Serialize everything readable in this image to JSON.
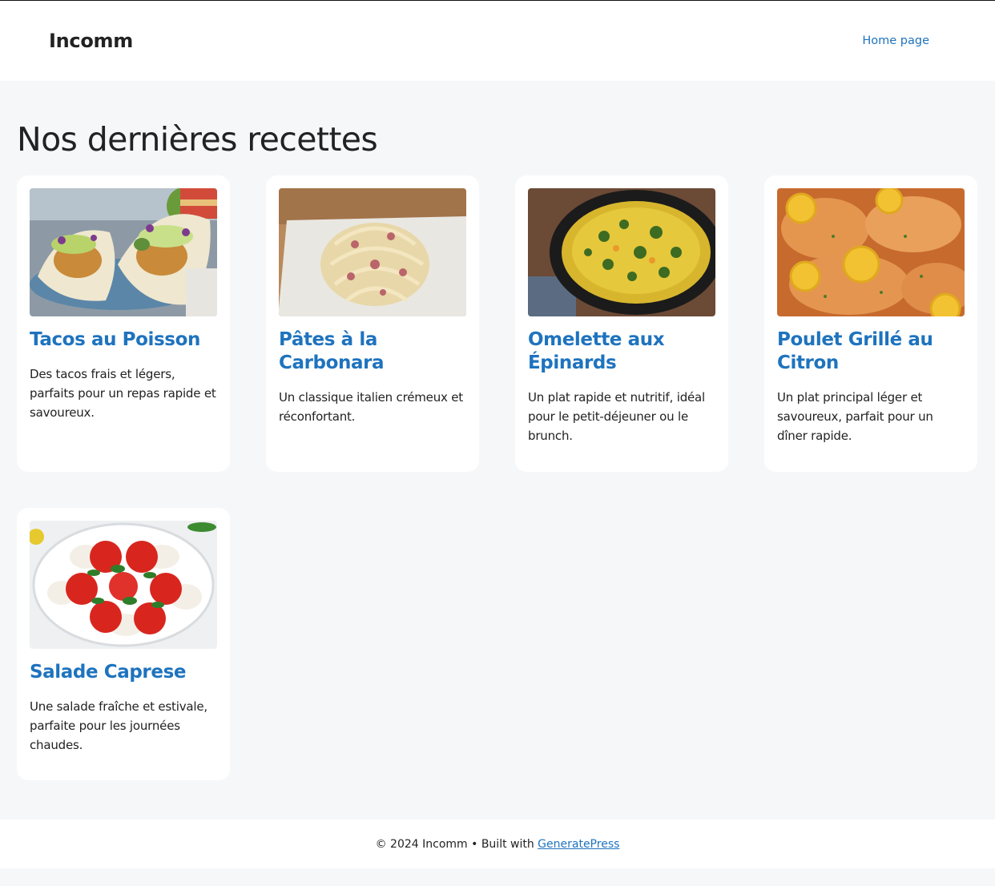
{
  "header": {
    "site_title": "Incomm",
    "nav": [
      {
        "label": "Home page"
      }
    ]
  },
  "main": {
    "heading": "Nos dernières recettes",
    "recipes": [
      {
        "title": "Tacos au Poisson",
        "description": "Des tacos frais et légers, parfaits pour un repas rapide et savoureux.",
        "image_icon": "fish-tacos-photo"
      },
      {
        "title": "Pâtes à la Carbonara",
        "description": "Un classique italien crémeux et réconfortant.",
        "image_icon": "carbonara-photo"
      },
      {
        "title": "Omelette aux Épinards",
        "description": "Un plat rapide et nutritif, idéal pour le petit-déjeuner ou le brunch.",
        "image_icon": "spinach-omelette-photo"
      },
      {
        "title": "Poulet Grillé au Citron",
        "description": "Un plat principal léger et savoureux, parfait pour un dîner rapide.",
        "image_icon": "lemon-chicken-photo"
      },
      {
        "title": "Salade Caprese",
        "description": "Une salade fraîche et estivale, parfaite pour les journées chaudes.",
        "image_icon": "caprese-salad-photo"
      }
    ]
  },
  "footer": {
    "text": "© 2024 Incomm • Built with ",
    "link_label": "GeneratePress"
  },
  "colors": {
    "link": "#1e73be",
    "page_background": "#f6f7f9",
    "card_background": "#ffffff",
    "text": "#222222"
  }
}
